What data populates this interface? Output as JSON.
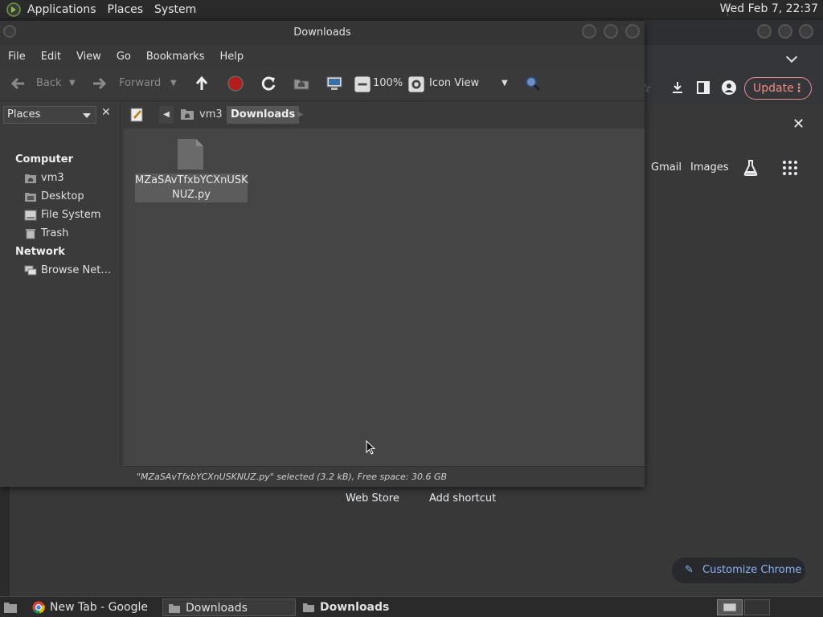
{
  "top_panel": {
    "menus": [
      "Applications",
      "Places",
      "System"
    ],
    "clock": "Wed Feb  7, 22:37"
  },
  "chrome": {
    "update_label": "Update",
    "links": {
      "gmail": "Gmail",
      "images": "Images"
    },
    "shortcuts": {
      "web_store": "Web Store",
      "add_shortcut": "Add shortcut"
    },
    "customize_label": "Customize Chrome"
  },
  "file_manager": {
    "title": "Downloads",
    "menu": [
      "File",
      "Edit",
      "View",
      "Go",
      "Bookmarks",
      "Help"
    ],
    "toolbar": {
      "back": "Back",
      "forward": "Forward",
      "zoom": "100%",
      "view_mode": "Icon View"
    },
    "sidebar": {
      "combo": "Places",
      "computer_header": "Computer",
      "computer_items": [
        "vm3",
        "Desktop",
        "File System",
        "Trash"
      ],
      "network_header": "Network",
      "network_items": [
        "Browse Net…"
      ]
    },
    "pathbar": {
      "segments": [
        "vm3",
        "Downloads"
      ]
    },
    "files": [
      {
        "name_line1": "MZaSAvTfxbYCXnUSK",
        "name_line2": "NUZ.py"
      }
    ],
    "status": "\"MZaSAvTfxbYCXnUSKNUZ.py\" selected (3.2 kB), Free space: 30.6 GB"
  },
  "taskbar": {
    "items": [
      "New Tab - Google ...",
      "Downloads",
      "Downloads"
    ]
  }
}
